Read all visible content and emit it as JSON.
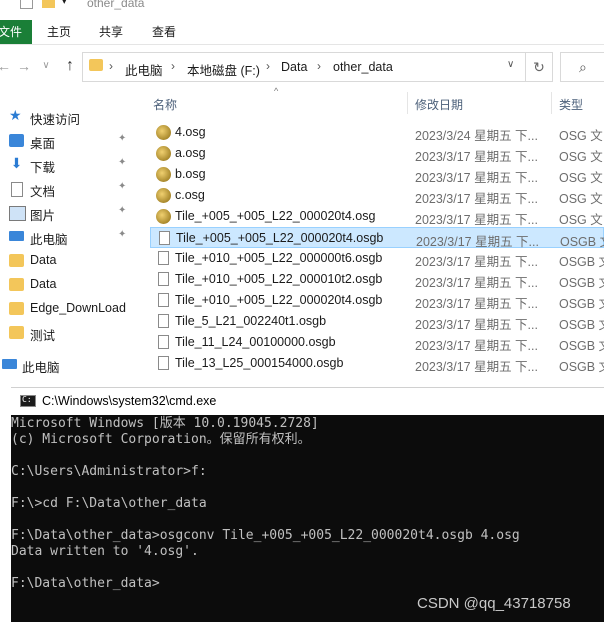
{
  "window": {
    "title": "other_data"
  },
  "ribbon": {
    "tabs": [
      "文件",
      "主页",
      "共享",
      "查看"
    ]
  },
  "address": {
    "crumbs": [
      "此电脑",
      "本地磁盘 (F:)",
      "Data",
      "other_data"
    ],
    "sep": "›",
    "back": "←",
    "forward": "→",
    "dropdown": "∨",
    "up": "↑",
    "refresh": "↻",
    "search_glyph": "⌕"
  },
  "nav": {
    "items": [
      {
        "label": "快速访问",
        "icon": "star-icon",
        "pinned": false
      },
      {
        "label": "桌面",
        "icon": "desktop-icon",
        "pinned": true
      },
      {
        "label": "下载",
        "icon": "download-icon",
        "pinned": true
      },
      {
        "label": "文档",
        "icon": "document-icon",
        "pinned": true
      },
      {
        "label": "图片",
        "icon": "picture-icon",
        "pinned": true
      },
      {
        "label": "此电脑",
        "icon": "computer-icon",
        "pinned": true
      },
      {
        "label": "Data",
        "icon": "folder-icon",
        "pinned": false
      },
      {
        "label": "Data",
        "icon": "folder-icon",
        "pinned": false
      },
      {
        "label": "Edge_DownLoad",
        "icon": "folder-icon",
        "pinned": false
      },
      {
        "label": "测试",
        "icon": "folder-icon",
        "pinned": false
      },
      {
        "label": "此电脑",
        "icon": "computer-icon",
        "pinned": false
      }
    ],
    "pin_glyph": "📌"
  },
  "columns": {
    "name": "名称",
    "date": "修改日期",
    "type": "类型"
  },
  "files": [
    {
      "name": "4.osg",
      "date": "2023/3/24 星期五 下...",
      "type": "OSG 文",
      "icon": "osg-file-icon",
      "selected": false
    },
    {
      "name": "a.osg",
      "date": "2023/3/17 星期五 下...",
      "type": "OSG 文",
      "icon": "osg-file-icon",
      "selected": false
    },
    {
      "name": "b.osg",
      "date": "2023/3/17 星期五 下...",
      "type": "OSG 文",
      "icon": "osg-file-icon",
      "selected": false
    },
    {
      "name": "c.osg",
      "date": "2023/3/17 星期五 下...",
      "type": "OSG 文",
      "icon": "osg-file-icon",
      "selected": false
    },
    {
      "name": "Tile_+005_+005_L22_000020t4.osg",
      "date": "2023/3/17 星期五 下...",
      "type": "OSG 文",
      "icon": "osg-file-icon",
      "selected": false
    },
    {
      "name": "Tile_+005_+005_L22_000020t4.osgb",
      "date": "2023/3/17 星期五 下...",
      "type": "OSGB 文",
      "icon": "file-icon",
      "selected": true
    },
    {
      "name": "Tile_+010_+005_L22_000000t6.osgb",
      "date": "2023/3/17 星期五 下...",
      "type": "OSGB 文",
      "icon": "file-icon",
      "selected": false
    },
    {
      "name": "Tile_+010_+005_L22_000010t2.osgb",
      "date": "2023/3/17 星期五 下...",
      "type": "OSGB 文",
      "icon": "file-icon",
      "selected": false
    },
    {
      "name": "Tile_+010_+005_L22_000020t4.osgb",
      "date": "2023/3/17 星期五 下...",
      "type": "OSGB 文",
      "icon": "file-icon",
      "selected": false
    },
    {
      "name": "Tile_5_L21_002240t1.osgb",
      "date": "2023/3/17 星期五 下...",
      "type": "OSGB 文",
      "icon": "file-icon",
      "selected": false
    },
    {
      "name": "Tile_11_L24_00100000.osgb",
      "date": "2023/3/17 星期五 下...",
      "type": "OSGB 文",
      "icon": "file-icon",
      "selected": false
    },
    {
      "name": "Tile_13_L25_000154000.osgb",
      "date": "2023/3/17 星期五 下...",
      "type": "OSGB 文",
      "icon": "file-icon",
      "selected": false
    }
  ],
  "cmd": {
    "title": "C:\\Windows\\system32\\cmd.exe",
    "lines": [
      "Microsoft Windows [版本 10.0.19045.2728]",
      "(c) Microsoft Corporation。保留所有权利。",
      "",
      "C:\\Users\\Administrator>f:",
      "",
      "F:\\>cd F:\\Data\\other_data",
      "",
      "F:\\Data\\other_data>osgconv Tile_+005_+005_L22_000020t4.osgb 4.osg",
      "Data written to '4.osg'.",
      "",
      "F:\\Data\\other_data>"
    ]
  },
  "watermark": "CSDN @qq_43718758",
  "colors": {
    "selection": "#cce8ff",
    "file_tab": "#1a7f37",
    "console_bg": "#0c0c0c"
  }
}
